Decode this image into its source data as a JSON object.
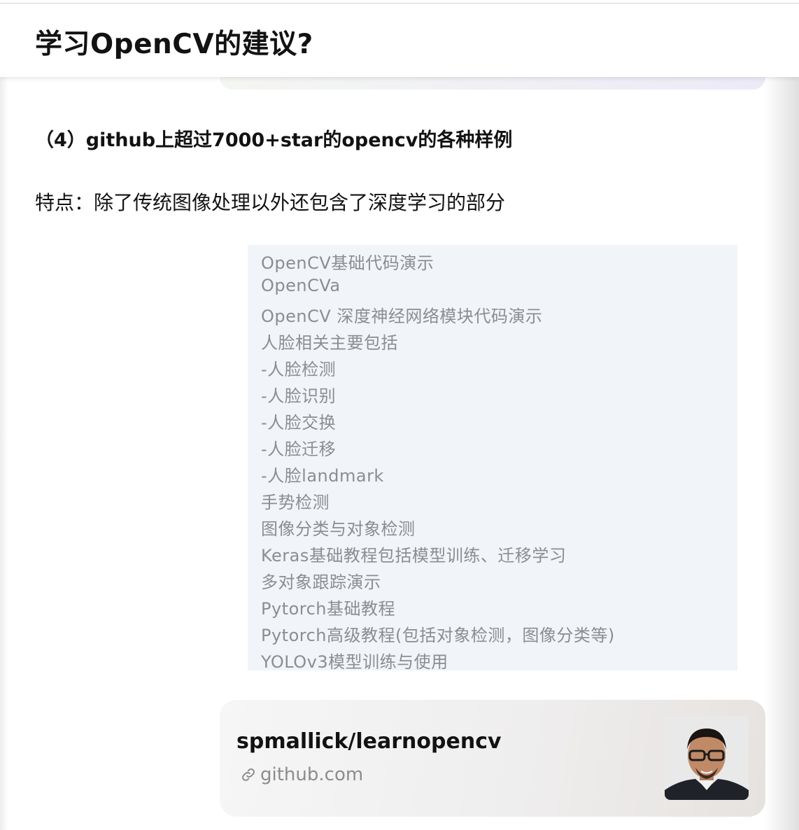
{
  "header": {
    "title": "学习OpenCV的建议?"
  },
  "article": {
    "section_heading": "（4）github上超过7000+star的opencv的各种样例",
    "feature_text": "特点：除了传统图像处理以外还包含了深度学习的部分",
    "list_items": [
      "OpenCV基础代码演示",
      "OpenCVa",
      "OpenCV 深度神经网络模块代码演示",
      "人脸相关主要包括",
      "-人脸检测",
      "-人脸识别",
      "-人脸交换",
      "-人脸迁移",
      "-人脸landmark",
      "手势检测",
      "图像分类与对象检测",
      "Keras基础教程包括模型训练、迁移学习",
      "多对象跟踪演示",
      "Pytorch基础教程",
      "Pytorch高级教程(包括对象检测，图像分类等)",
      "YOLOv3模型训练与使用"
    ]
  },
  "link_card": {
    "title": "spmallick/learnopencv",
    "domain": "github.com",
    "icon": "link-icon"
  }
}
